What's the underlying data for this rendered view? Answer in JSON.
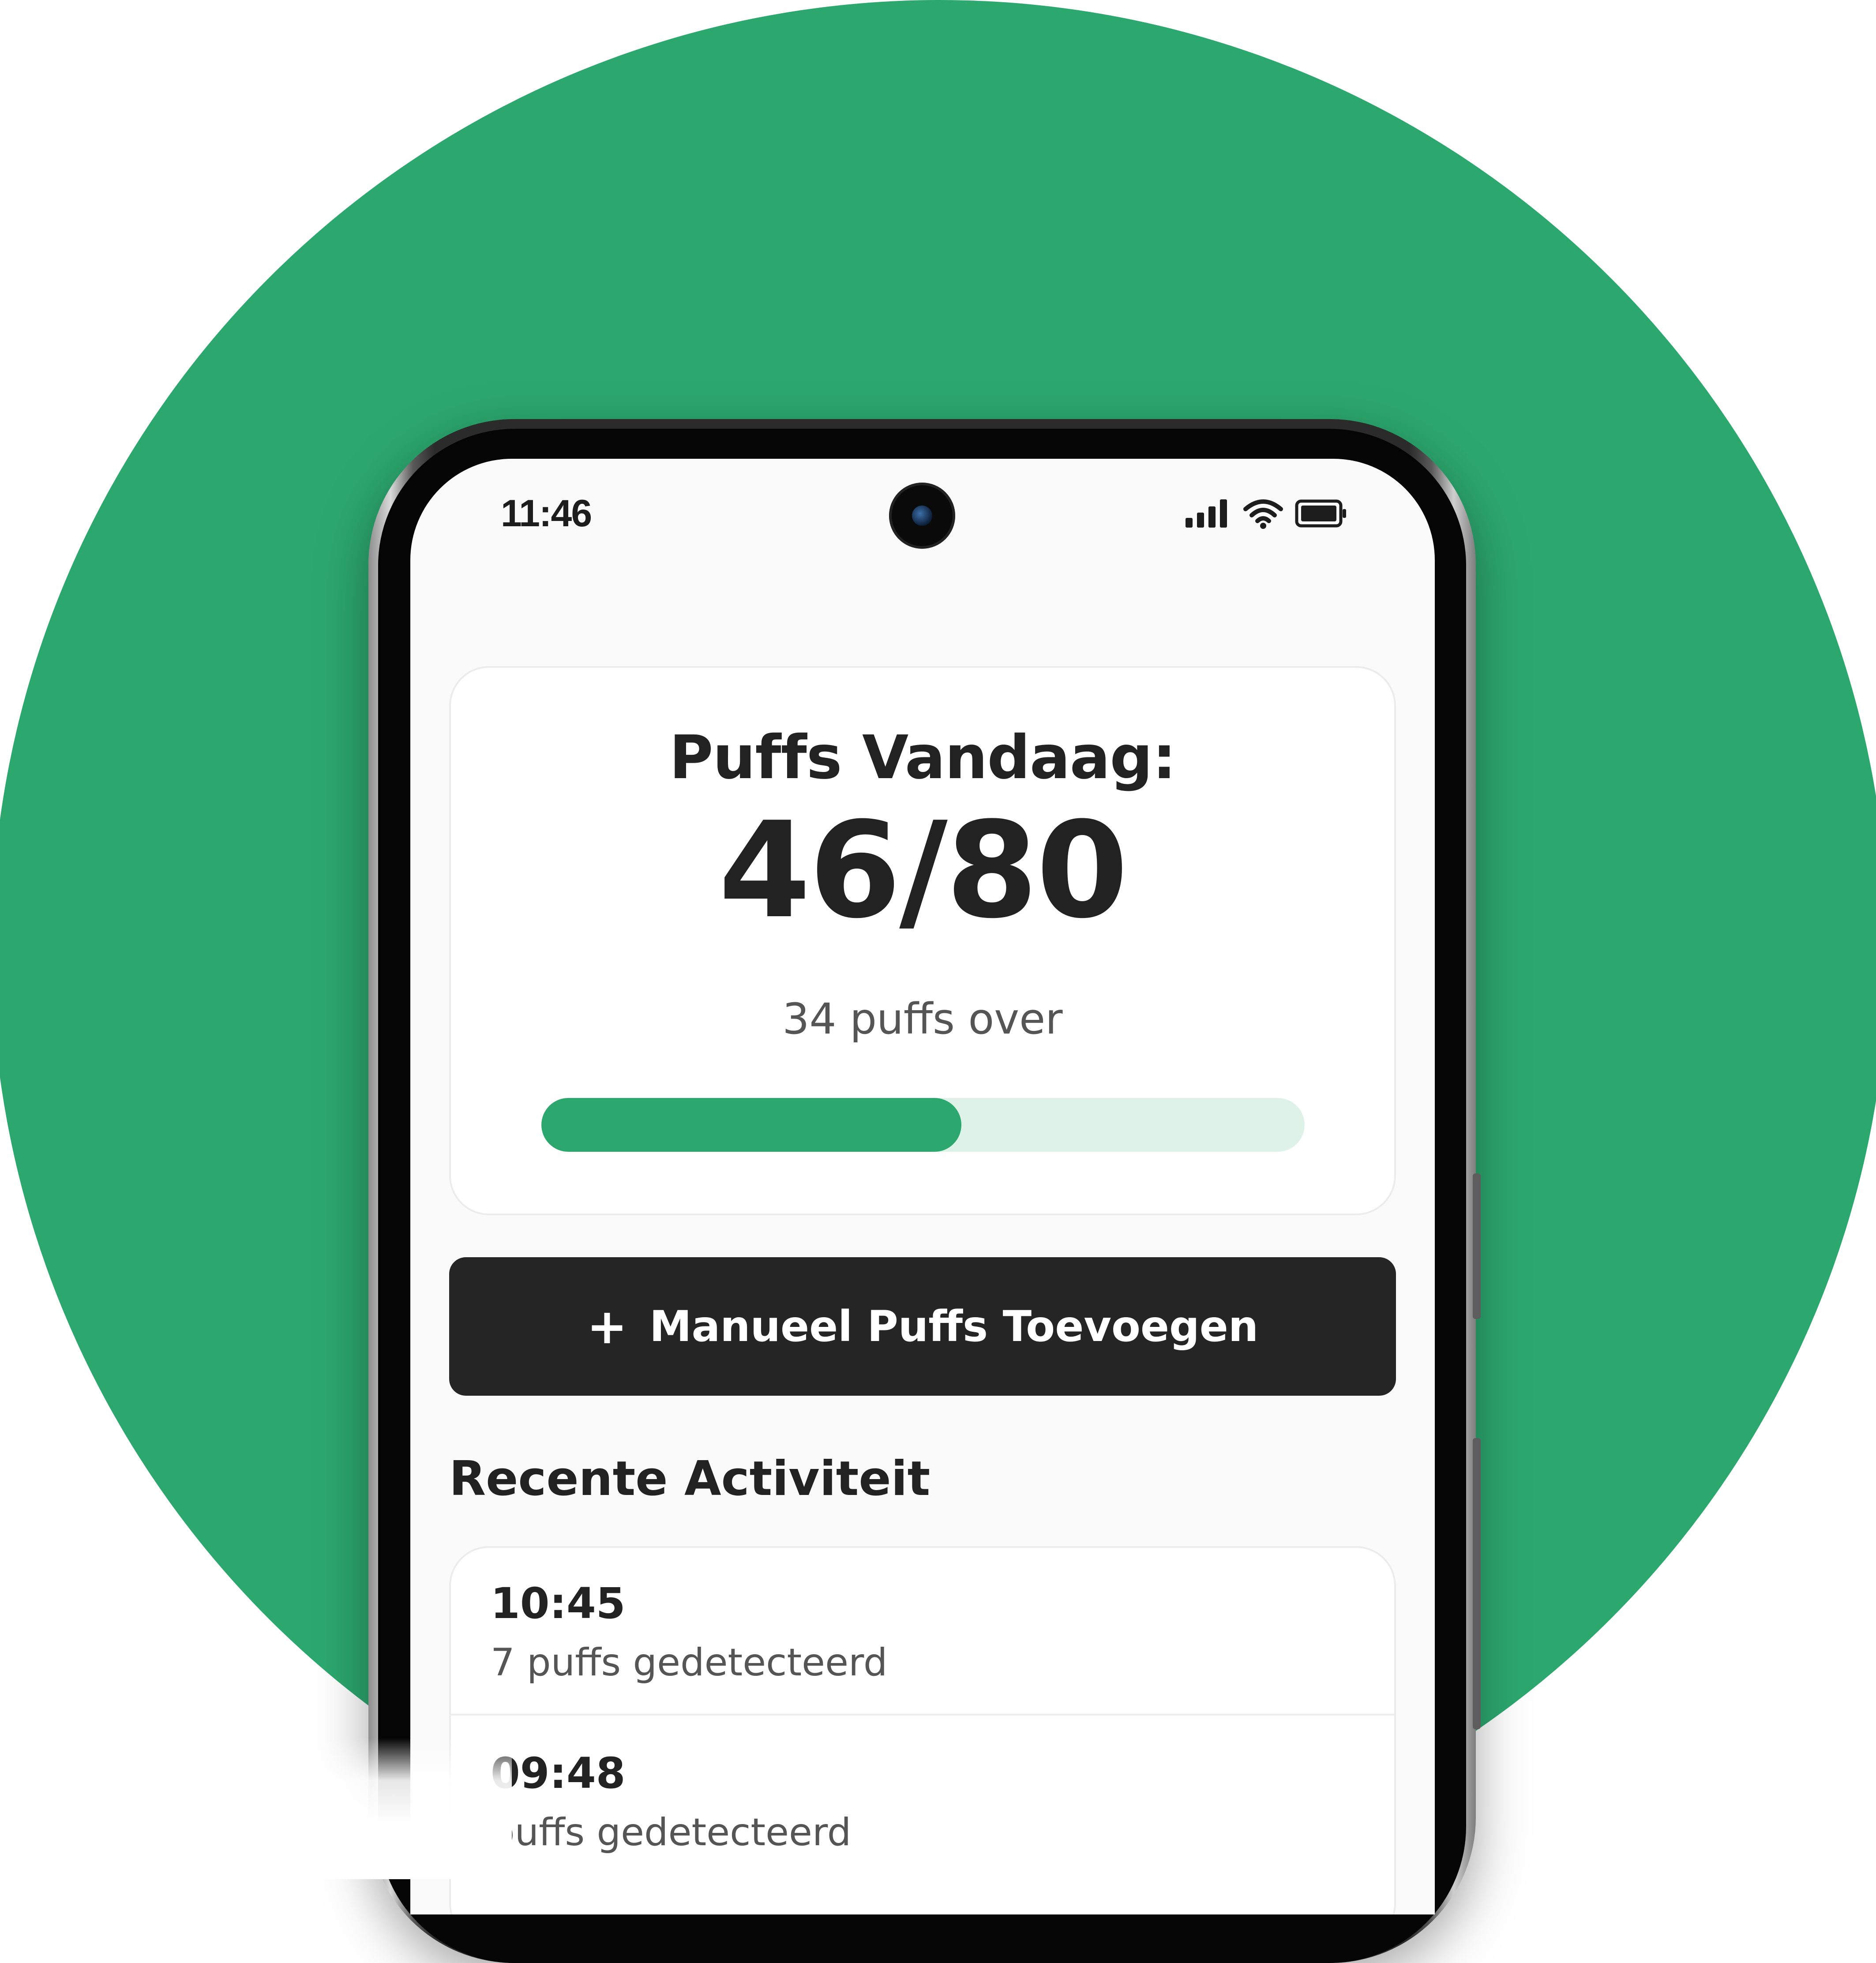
{
  "status_bar": {
    "time": "11:46",
    "signal_icon": "signal-bars-icon",
    "wifi_icon": "wifi-icon",
    "battery_icon": "battery-icon"
  },
  "counter": {
    "title": "Puffs Vandaag:",
    "value": "46/80",
    "remaining": "34 puffs over",
    "progress_fraction": 0.55,
    "progress_color": "#2ca86e",
    "track_color": "#dff2e8"
  },
  "add_button": {
    "icon": "plus-icon",
    "label": "Manueel Puffs Toevoegen"
  },
  "recent": {
    "heading": "Recente Activiteit",
    "items": [
      {
        "time": "10:45",
        "description": "7 puffs gedetecteerd"
      },
      {
        "time": "09:48",
        "description": "puffs gedetecteerd"
      }
    ]
  },
  "colors": {
    "brand_green": "#2ca86e",
    "button_dark": "#252525"
  }
}
